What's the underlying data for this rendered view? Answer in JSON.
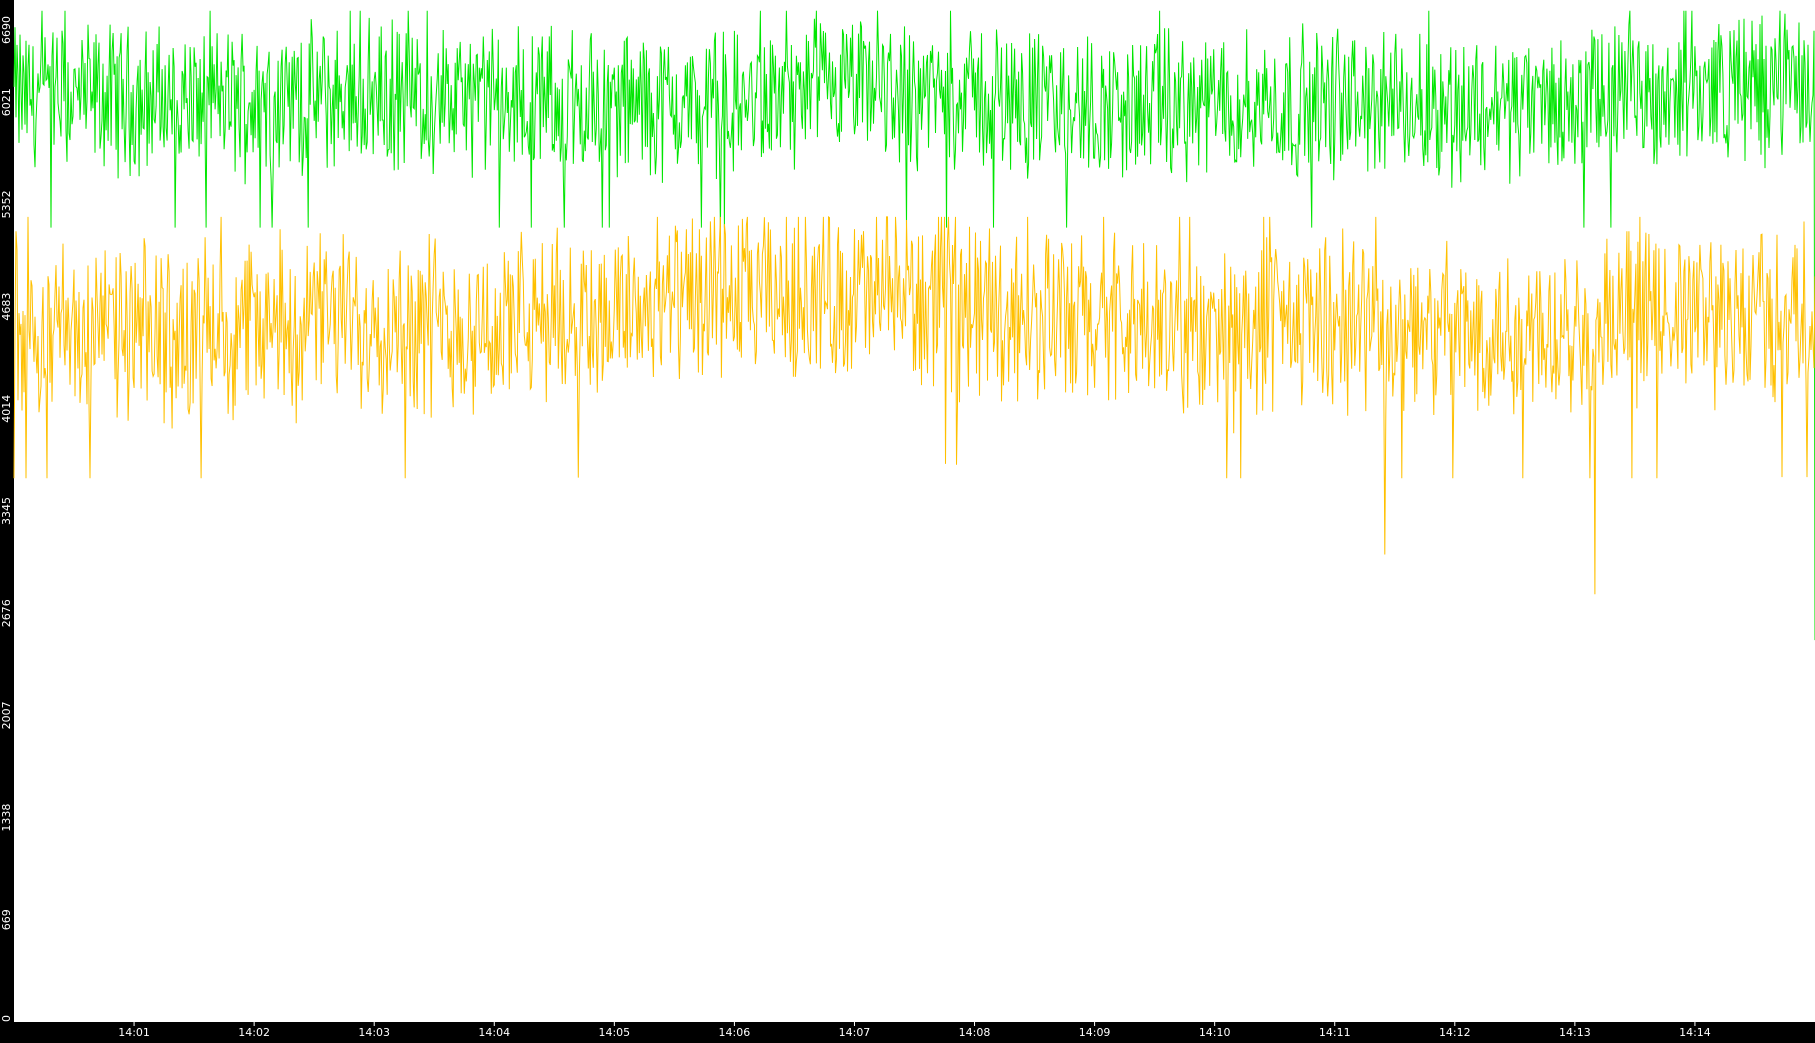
{
  "chart_data": {
    "type": "line",
    "title": "",
    "xlabel": "",
    "ylabel": "",
    "background_color": "#000000",
    "plot_background_color": "#ffffff",
    "tick_label_color": "#ffffff",
    "grid": false,
    "legend": "none",
    "x_range": [
      "14:00",
      "14:15"
    ],
    "ylim": [
      0,
      6690
    ],
    "y_ticks": [
      0,
      669,
      1338,
      2007,
      2676,
      3345,
      4014,
      4683,
      5352,
      6021,
      6690
    ],
    "x_ticks": [
      "14:01",
      "14:02",
      "14:03",
      "14:04",
      "14:05",
      "14:06",
      "14:07",
      "14:08",
      "14:09",
      "14:10",
      "14:11",
      "14:12",
      "14:13",
      "14:14"
    ],
    "series": [
      {
        "color": "#00e600",
        "minute_means": [
          6060,
          6040,
          6030,
          6060,
          6020,
          6010,
          6000,
          6090,
          6060,
          5980,
          6000,
          6020,
          5990,
          6010,
          6120
        ],
        "approx_range": [
          5200,
          6620
        ],
        "end_drop": 2500
      },
      {
        "color": "#ffc000",
        "minute_means": [
          4580,
          4500,
          4560,
          4610,
          4540,
          4650,
          4720,
          4760,
          4690,
          4560,
          4500,
          4580,
          4500,
          4580,
          4620
        ],
        "approx_range": [
          3560,
          5270
        ],
        "dips": [
          {
            "time": "14:11:25",
            "value": 3060
          },
          {
            "time": "14:13:10",
            "value": 2800
          }
        ],
        "end_drop": 0
      }
    ]
  }
}
